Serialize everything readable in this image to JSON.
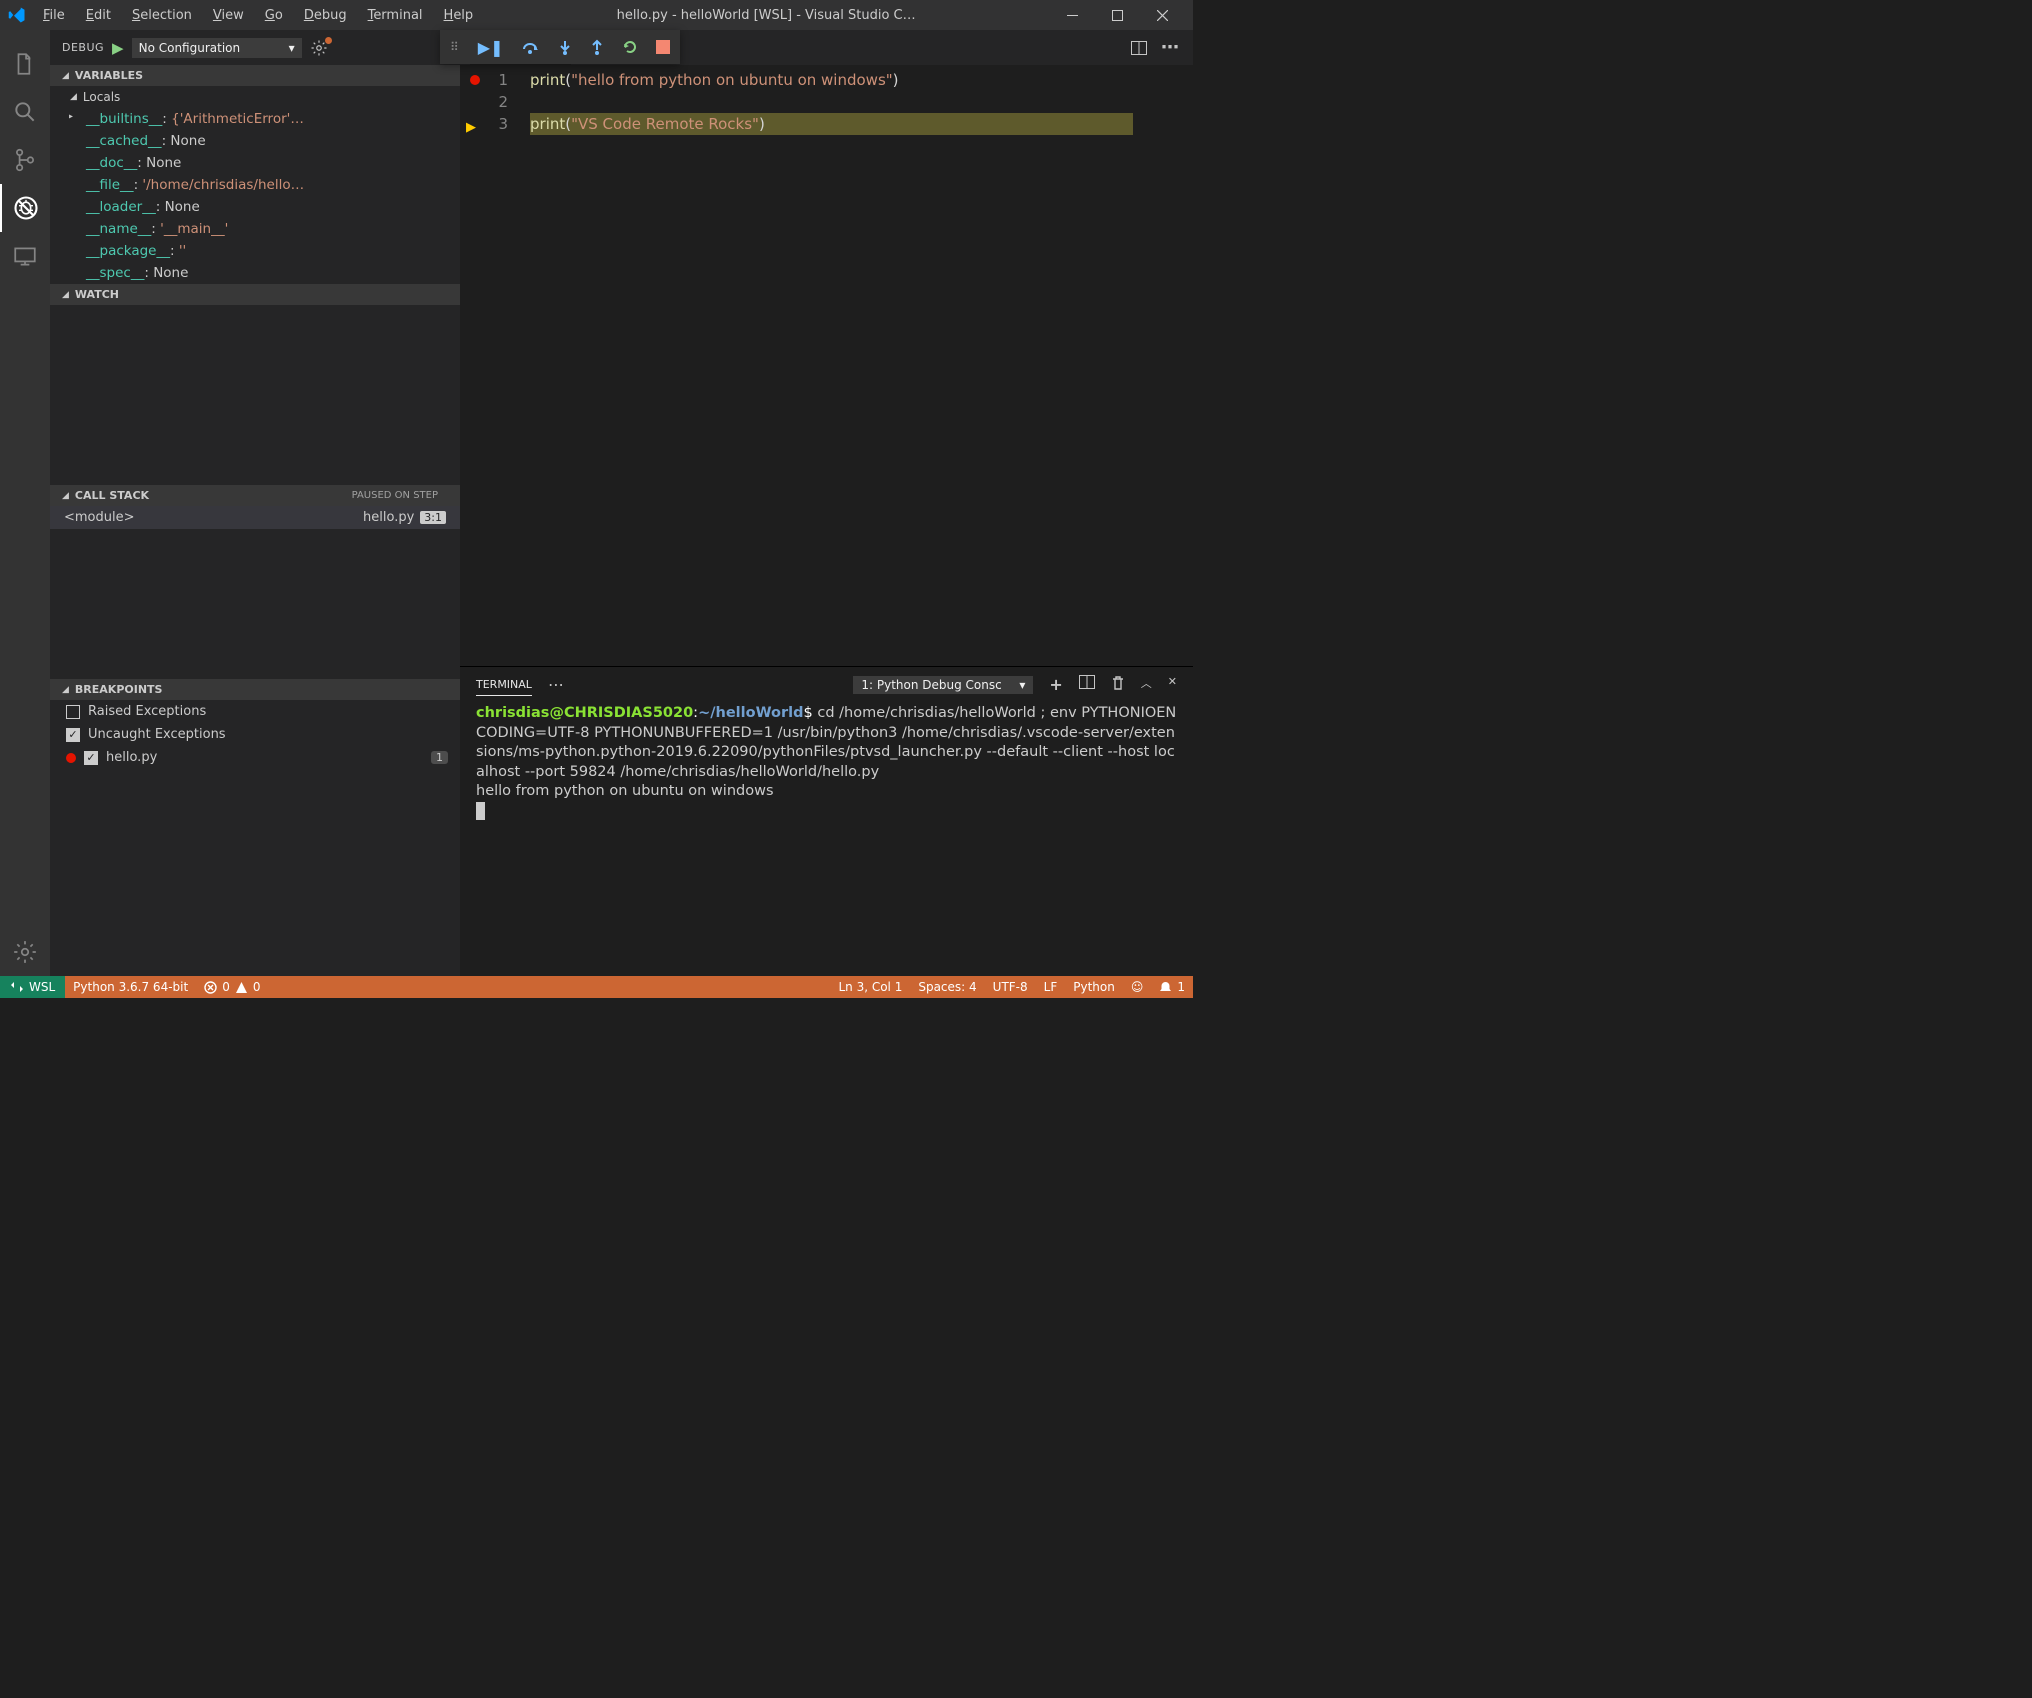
{
  "window": {
    "title": "hello.py - helloWorld [WSL] - Visual Studio C…"
  },
  "menus": [
    "File",
    "Edit",
    "Selection",
    "View",
    "Go",
    "Debug",
    "Terminal",
    "Help"
  ],
  "activity": {
    "items": [
      "files",
      "search",
      "scm",
      "debug",
      "remote"
    ]
  },
  "debug_panel": {
    "title": "DEBUG",
    "config": "No Configuration",
    "sections": {
      "variables": "VARIABLES",
      "locals": "Locals",
      "watch": "WATCH",
      "callstack": "CALL STACK",
      "callstack_status": "PAUSED ON STEP",
      "breakpoints": "BREAKPOINTS"
    },
    "vars": [
      {
        "key": "__builtins__",
        "sep": ": ",
        "val": "{'ArithmeticError'…",
        "expandable": true
      },
      {
        "key": "__cached__",
        "sep": ": ",
        "val": "None"
      },
      {
        "key": "__doc__",
        "sep": ": ",
        "val": "None"
      },
      {
        "key": "__file__",
        "sep": ": ",
        "val": "'/home/chrisdias/hello…"
      },
      {
        "key": "__loader__",
        "sep": ": ",
        "val": "None"
      },
      {
        "key": "__name__",
        "sep": ": ",
        "val": "'__main__'"
      },
      {
        "key": "__package__",
        "sep": ": ",
        "val": "''"
      },
      {
        "key": "__spec__",
        "sep": ": ",
        "val": "None"
      }
    ],
    "stack": [
      {
        "name": "<module>",
        "file": "hello.py",
        "pos": "3:1"
      }
    ],
    "breakpoints": [
      {
        "checked": false,
        "label": "Raised Exceptions"
      },
      {
        "checked": true,
        "label": "Uncaught Exceptions"
      },
      {
        "checked": true,
        "label": "hello.py",
        "dot": true,
        "badge": "1"
      }
    ]
  },
  "editor": {
    "tab": "hello.py",
    "lines": [
      {
        "n": "1",
        "bp": true,
        "tokens": [
          [
            "fn",
            "print"
          ],
          [
            "p",
            "("
          ],
          [
            "str",
            "\"hello from python on ubuntu on windows\""
          ],
          [
            "p",
            ")"
          ]
        ]
      },
      {
        "n": "2",
        "tokens": []
      },
      {
        "n": "3",
        "arrow": true,
        "highlight": true,
        "tokens": [
          [
            "fn",
            "print"
          ],
          [
            "p",
            "("
          ],
          [
            "str",
            "\"VS Code Remote Rocks\""
          ],
          [
            "p",
            ")"
          ]
        ]
      }
    ]
  },
  "panel": {
    "tab_active": "TERMINAL",
    "selector": "1: Python Debug Consc",
    "terminal": {
      "user": "chrisdias",
      "host": "CHRISDIAS5020",
      "path": "~/helloWorld",
      "sep": ":",
      "dollar": "$",
      "command": " cd /home/chrisdias/helloWorld ; env PYTHONIOENCODING=UTF-8 PYTHONUNBUFFERED=1 /usr/bin/python3 /home/chrisdias/.vscode-server/extensions/ms-python.python-2019.6.22090/pythonFiles/ptvsd_launcher.py --default --client --host localhost --port 59824 /home/chrisdias/helloWorld/hello.py",
      "output": "hello from python on ubuntu on windows"
    }
  },
  "statusbar": {
    "remote": "WSL",
    "python": "Python 3.6.7 64-bit",
    "errors": "0",
    "warnings": "0",
    "pos": "Ln 3, Col 1",
    "spaces": "Spaces: 4",
    "encoding": "UTF-8",
    "eol": "LF",
    "lang": "Python",
    "bell": "1"
  }
}
